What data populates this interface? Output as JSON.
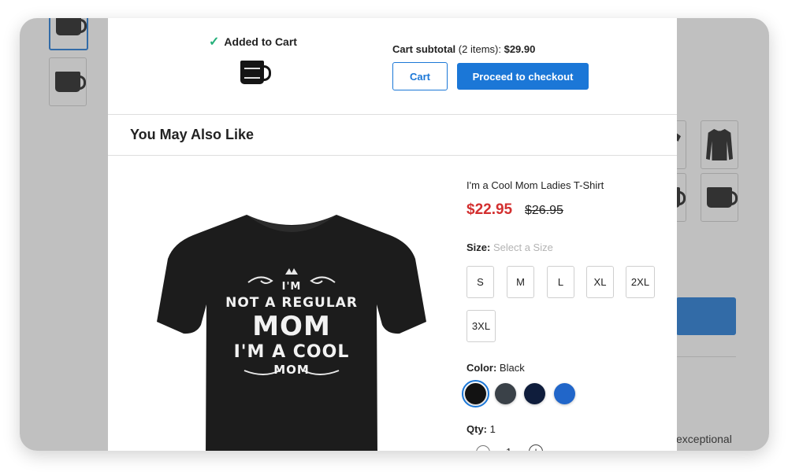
{
  "modal": {
    "added_label": "Added to Cart",
    "subtotal_label": "Cart subtotal",
    "subtotal_items": "(2 items):",
    "subtotal_value": "$29.90",
    "cart_button": "Cart",
    "checkout_button": "Proceed to checkout",
    "section_title": "You May Also Like"
  },
  "product": {
    "name": "I'm a Cool Mom Ladies T-Shirt",
    "price": "$22.95",
    "old_price": "$26.95",
    "shirt_print": {
      "line1": "I'M",
      "line2": "NOT A REGULAR",
      "line3": "MOM",
      "line4": "I'M A COOL",
      "line5": "MOM"
    },
    "size_label": "Size:",
    "size_placeholder": "Select a Size",
    "sizes": [
      "S",
      "M",
      "L",
      "XL",
      "2XL",
      "3XL"
    ],
    "color_label": "Color:",
    "color_value": "Black",
    "colors": [
      "#121212",
      "#3a4148",
      "#0f1d3c",
      "#2166c9"
    ],
    "qty_label": "Qty:",
    "qty_value": "1"
  },
  "background_page": {
    "snippet_text": "exceptional"
  }
}
